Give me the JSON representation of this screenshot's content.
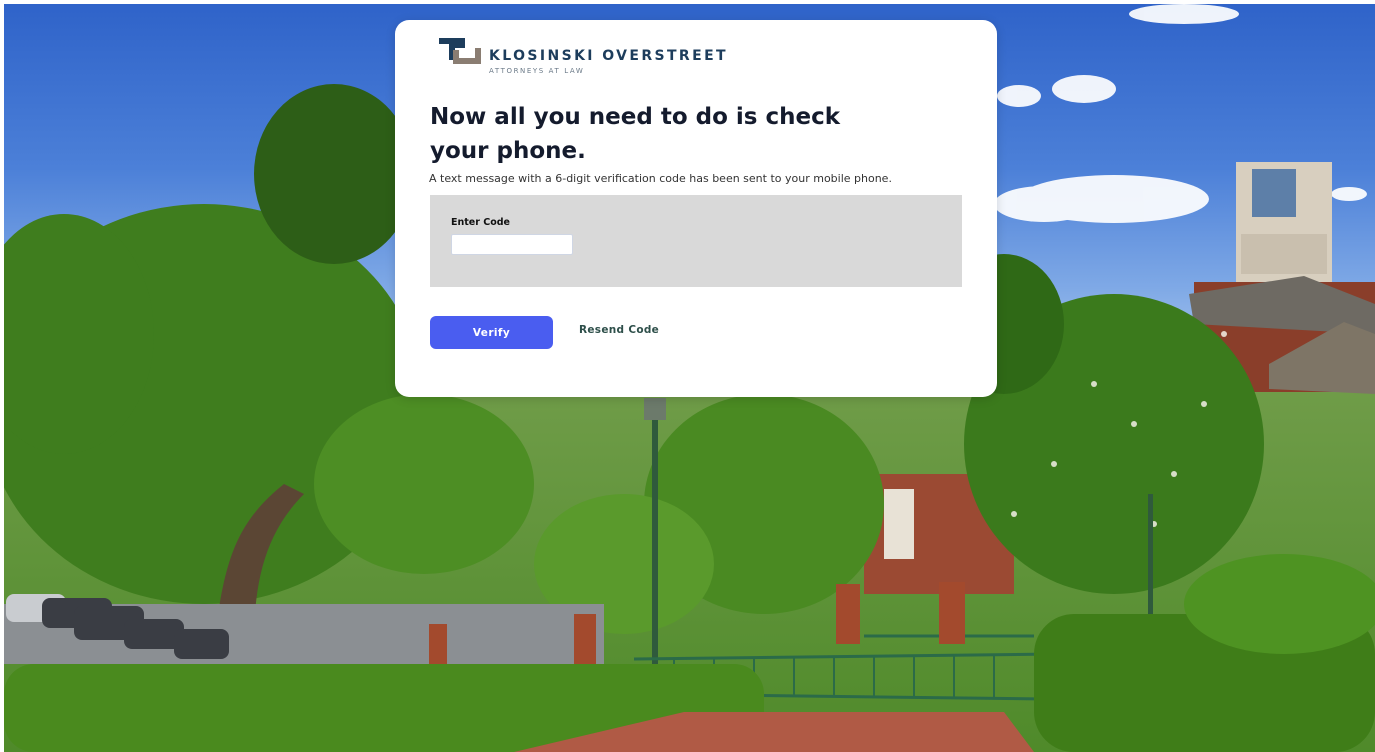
{
  "brand": {
    "name": "KLOSINSKI OVERSTREET",
    "tagline": "ATTORNEYS AT LAW",
    "colors": {
      "mark_dark": "#1d3d5c",
      "mark_light": "#8a7d72"
    }
  },
  "verification": {
    "title": "Now all you need to do is check your phone.",
    "subtitle": "A text message with a 6-digit verification code has been sent to your mobile phone.",
    "code_label": "Enter Code",
    "code_value": "",
    "code_placeholder": ""
  },
  "actions": {
    "verify_label": "Verify",
    "resend_label": "Resend Code"
  },
  "colors": {
    "accent": "#4a5df0",
    "panel": "#d9d9d9",
    "link": "#2e4f4a"
  }
}
